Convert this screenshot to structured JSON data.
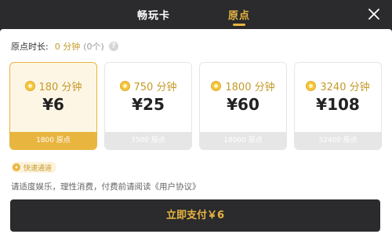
{
  "header": {
    "tabs": [
      {
        "label": "畅玩卡",
        "active": false
      },
      {
        "label": "原点",
        "active": true
      }
    ],
    "close_icon": "close-icon"
  },
  "duration": {
    "label": "原点时长:",
    "value": "0 分钟",
    "count": "(0个)",
    "help_icon": "?"
  },
  "cards": [
    {
      "minutes": "180 分钟",
      "price": "¥6",
      "points": "1800 原点",
      "selected": true
    },
    {
      "minutes": "750 分钟",
      "price": "¥25",
      "points": "7500 原点",
      "selected": false
    },
    {
      "minutes": "1800 分钟",
      "price": "¥60",
      "points": "18000 原点",
      "selected": false
    },
    {
      "minutes": "3240 分钟",
      "price": "¥108",
      "points": "32400 原点",
      "selected": false
    }
  ],
  "fast_channel": {
    "label": "快速通道",
    "icon": "lightning-icon"
  },
  "notice": {
    "text": "请适度娱乐，理性消费，付费前请阅读",
    "link": "《用户协议》"
  },
  "pay_button": {
    "label": "立即支付￥6"
  },
  "colors": {
    "accent": "#e8b53f",
    "dark": "#2b2b2d",
    "selected_bg": "#fdf6e5"
  }
}
